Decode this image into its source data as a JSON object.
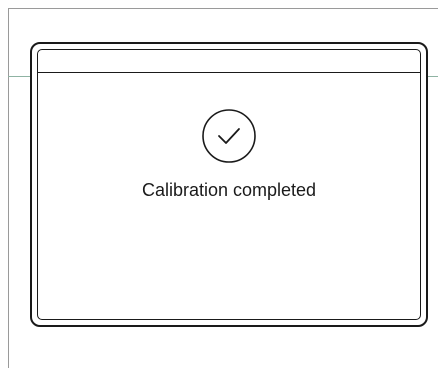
{
  "dialog": {
    "icon": "check-circle-icon",
    "message": "Calibration completed"
  },
  "colors": {
    "border": "#1a1a1a",
    "background": "#ffffff",
    "frame": "#9a9a9a",
    "divider": "#8fb3a3"
  }
}
